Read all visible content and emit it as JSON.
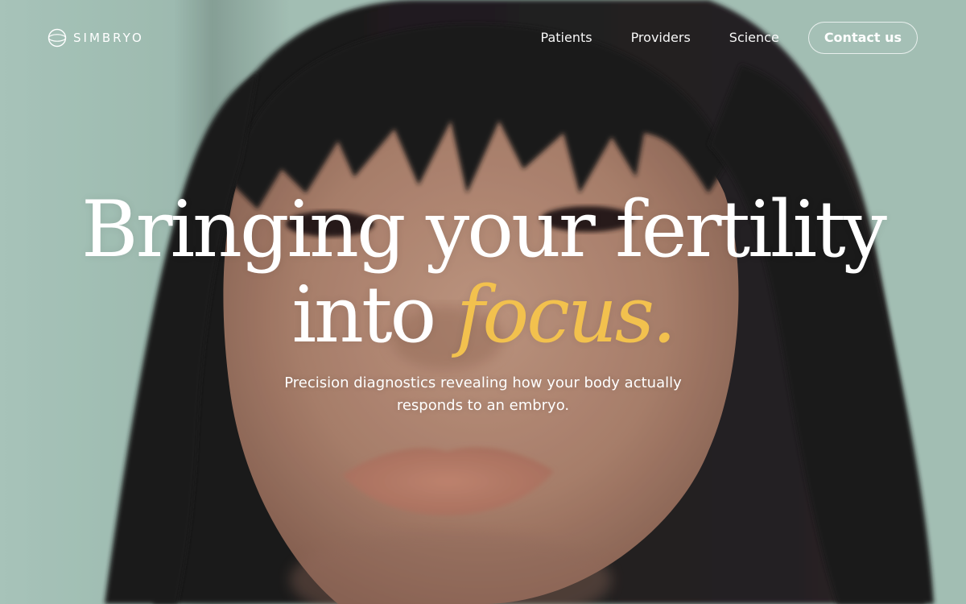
{
  "brand": {
    "name": "SIMBRYO",
    "logo_icon": "simbryo-ring-icon"
  },
  "nav": {
    "items": [
      {
        "label": "Patients"
      },
      {
        "label": "Providers"
      },
      {
        "label": "Science"
      }
    ],
    "cta_label": "Contact us"
  },
  "hero": {
    "headline_line1": "Bringing your fertility",
    "headline_line2_prefix": "into",
    "headline_accent": "focus.",
    "subtitle_line1": "Precision diagnostics revealing how your body actually",
    "subtitle_line2": "responds to an embryo.",
    "background": "portrait photo of a woman with dark hair and bangs"
  },
  "colors": {
    "accent": "#f2c14e",
    "text": "#ffffff",
    "background": "#adcabf"
  }
}
